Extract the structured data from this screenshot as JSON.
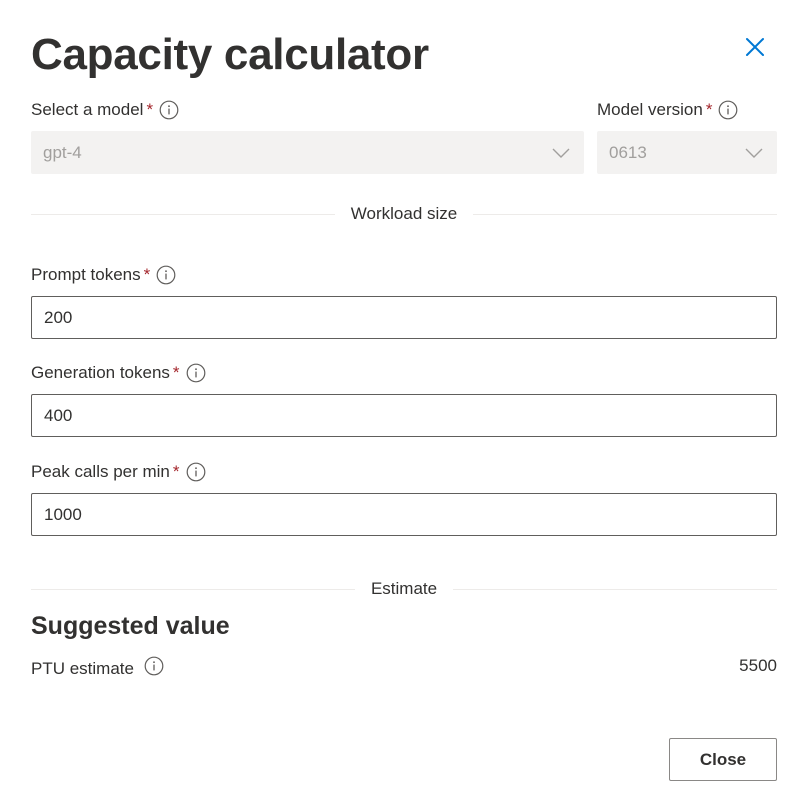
{
  "dialog": {
    "title": "Capacity calculator",
    "close_icon": "close-icon"
  },
  "model": {
    "label": "Select a model",
    "required_mark": "*",
    "selected": "gpt-4"
  },
  "version": {
    "label": "Model version",
    "required_mark": "*",
    "selected": "0613"
  },
  "workload_section": {
    "label": "Workload size"
  },
  "prompt_tokens": {
    "label": "Prompt tokens",
    "required_mark": "*",
    "value": "200"
  },
  "generation_tokens": {
    "label": "Generation tokens",
    "required_mark": "*",
    "value": "400"
  },
  "peak_calls": {
    "label": "Peak calls per min",
    "required_mark": "*",
    "value": "1000"
  },
  "estimate_section": {
    "label": "Estimate"
  },
  "suggested": {
    "title": "Suggested value",
    "ptu_label": "PTU estimate",
    "ptu_value": "5500"
  },
  "footer": {
    "close_label": "Close"
  },
  "colors": {
    "accent": "#0078d4",
    "required": "#a4262c",
    "disabled_bg": "#f3f2f1",
    "disabled_text": "#a19f9d",
    "text": "#323130"
  }
}
